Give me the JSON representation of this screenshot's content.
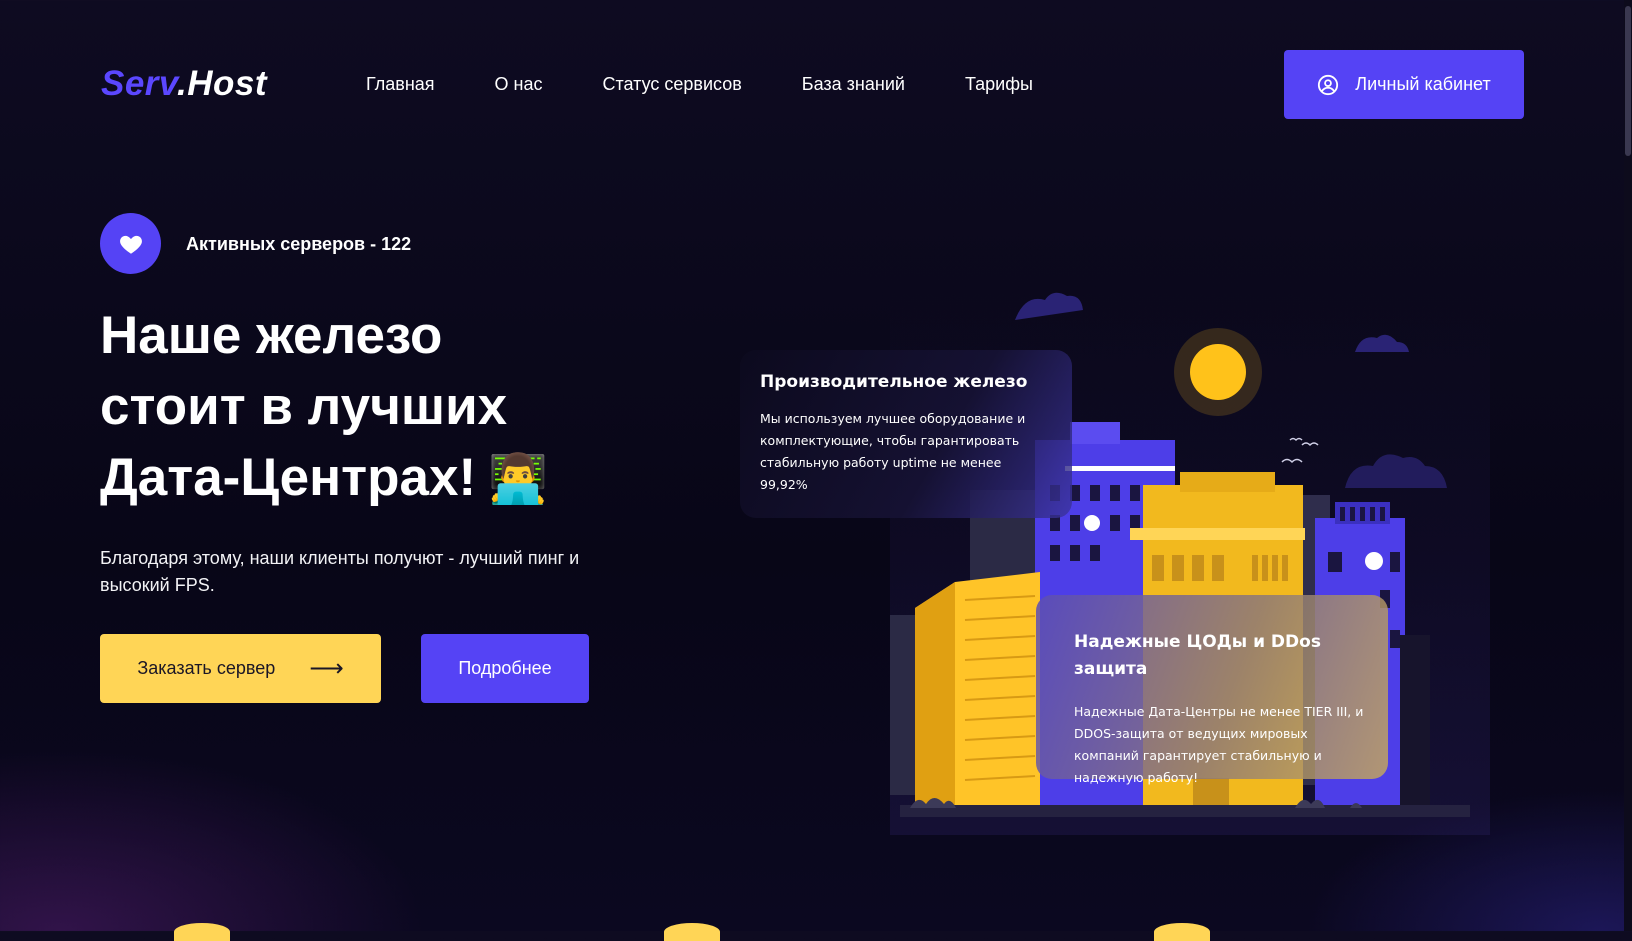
{
  "header": {
    "logo_part1": "Serv",
    "logo_part2": ".Host",
    "nav": [
      "Главная",
      "О нас",
      "Статус сервисов",
      "База знаний",
      "Тарифы"
    ],
    "account_button": "Личный кабинет",
    "account_icon": "user-circle-icon"
  },
  "hero": {
    "badge_icon": "heart-icon",
    "active_servers": "Активных серверов - 122",
    "title_lines": [
      "Наше железо",
      "стоит в лучших",
      "Дата-Центрах!"
    ],
    "title_emoji": "👨‍💻",
    "subtitle": "Благодаря этому, наши клиенты получют - лучший пинг и высокий FPS.",
    "order_button": "Заказать сервер",
    "order_arrow": "⟶",
    "more_button": "Подробнее"
  },
  "features": [
    {
      "title": "Производительное железо",
      "text": "Мы используем лучшее оборудование и комплектующие, чтобы гарантировать стабильную работу uptime не менее 99,92%"
    },
    {
      "title": "Надежные ЦОДы и DDos защита",
      "text": "Надежные Дата-Центры не менее TIER III, и DDOS-защита от ведущих мировых компаний гарантирует стабильную и надежную работу!"
    }
  ],
  "colors": {
    "accent": "#5543f5",
    "yellow": "#ffd556",
    "background": "#0a0819"
  }
}
